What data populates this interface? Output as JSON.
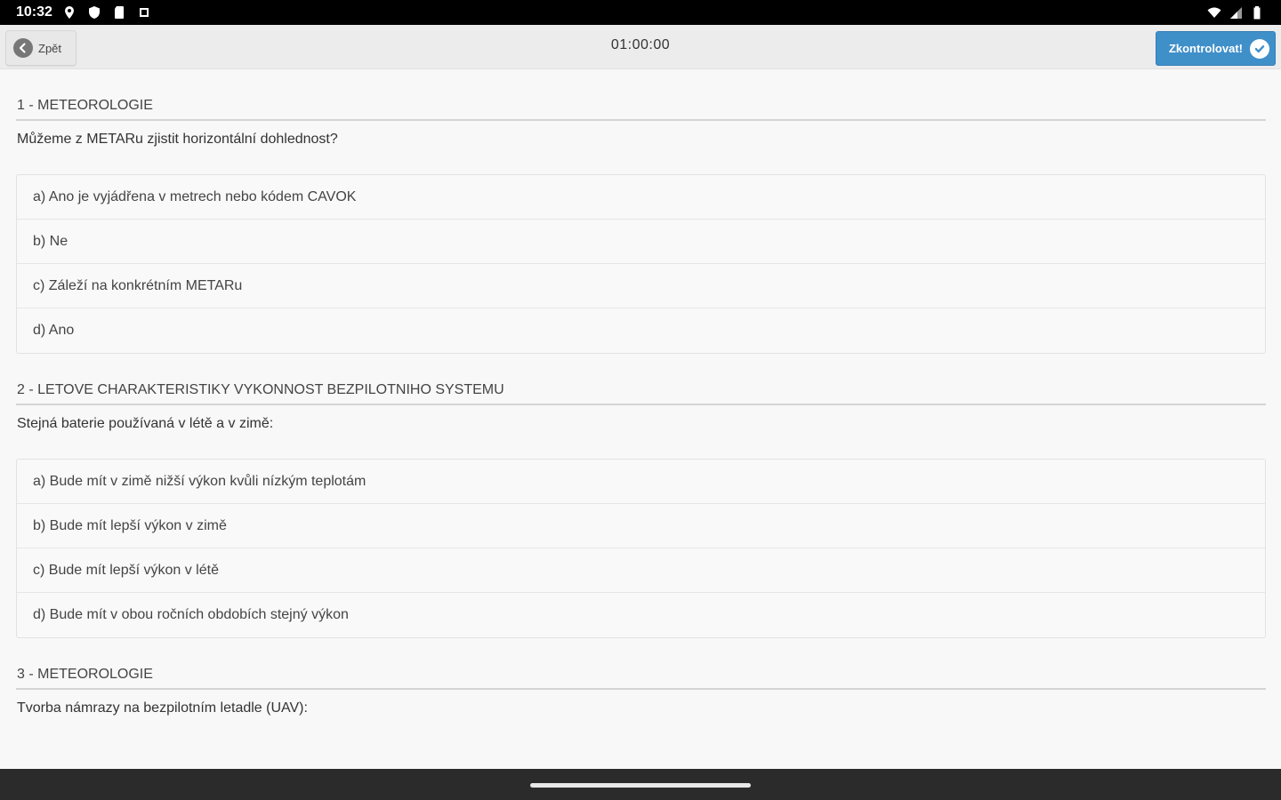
{
  "status_bar": {
    "time": "10:32",
    "left_icons": [
      "location-icon",
      "shield-icon",
      "sd-card-icon",
      "notification-icon"
    ],
    "right_icons": [
      "wifi-icon",
      "signal-icon",
      "battery-icon"
    ]
  },
  "toolbar": {
    "back_label": "Zpět",
    "timer": "01:00:00",
    "check_label": "Zkontrolovat!"
  },
  "questions": [
    {
      "heading": "1 - METEOROLOGIE",
      "text": "Můžeme z METARu zjistit horizontální dohlednost?",
      "answers": [
        "a) Ano je vyjádřena v metrech nebo kódem CAVOK",
        "b) Ne",
        "c) Záleží na konkrétním METARu",
        "d) Ano"
      ]
    },
    {
      "heading": "2 - LETOVE CHARAKTERISTIKY VYKONNOST BEZPILOTNIHO SYSTEMU",
      "text": "Stejná baterie používaná v létě a v zimě:",
      "answers": [
        "a) Bude mít v zimě nižší výkon kvůli nízkým teplotám",
        "b) Bude mít lepší výkon v zimě",
        "c) Bude mít lepší výkon v létě",
        "d) Bude mít v obou ročních obdobích stejný výkon"
      ]
    },
    {
      "heading": "3 - METEOROLOGIE",
      "text": "Tvorba námrazy na bezpilotním letadle (UAV):",
      "answers": []
    }
  ],
  "colors": {
    "accent": "#3f8fc9",
    "background": "#f8f8f8",
    "nav_bar": "#2b2b2b"
  }
}
